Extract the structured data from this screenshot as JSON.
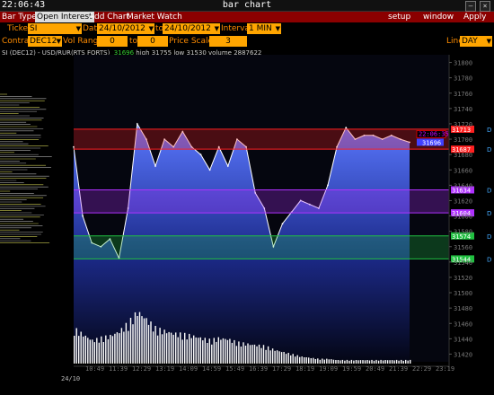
{
  "window": {
    "clock": "22:06:43",
    "title": "bar chart"
  },
  "menu": {
    "items": [
      "Bar Type",
      "Open Interest",
      "Add Chart",
      "Market Watch"
    ],
    "active": "Open Interest",
    "right": [
      "setup",
      "window",
      "Apply"
    ]
  },
  "controls": {
    "ticker_label": "Ticker",
    "ticker_value": "SI",
    "date_label": "Date",
    "date_from": "24/10/2012",
    "to_label": "to",
    "date_to": "24/10/2012",
    "interval_label": "Interval",
    "interval_value": "1 MIN",
    "contract_label": "Contract",
    "contract_value": "DEC12",
    "vol_range_label": "Vol Range",
    "vol_from": "0",
    "vol_to_label": "to",
    "vol_to": "0",
    "price_scale_label": "Price Scale",
    "price_scale_value": "3",
    "line_label": "Line",
    "line_value": "DAY"
  },
  "info": {
    "symbol": "SI (DEC12) - USD/RUR(RTS FORTS)",
    "last": "31696",
    "high_label": "high",
    "high": "31755",
    "low_label": "low",
    "low": "31530",
    "volume_label": "volume",
    "volume": "2887622"
  },
  "price_axis": [
    "31800",
    "31780",
    "31760",
    "31740",
    "31720",
    "31700",
    "31680",
    "31660",
    "31640",
    "31620",
    "31600",
    "31580",
    "31560",
    "31540",
    "31520",
    "31500",
    "31480",
    "31460",
    "31440",
    "31420"
  ],
  "time_axis": [
    "10:49",
    "11:39",
    "12:29",
    "13:19",
    "14:09",
    "14:59",
    "15:49",
    "16:39",
    "17:29",
    "18:19",
    "19:09",
    "19:59",
    "20:49",
    "21:39",
    "22:29",
    "23:19"
  ],
  "date_label": "24/10",
  "bands": [
    {
      "color": "#ff2020",
      "top": "31713",
      "bottom": "31687",
      "label_top": "31713",
      "label_bottom": "31687"
    },
    {
      "color": "#b030ff",
      "top": "31634",
      "bottom": "31604",
      "label_top": "31634",
      "label_bottom": "31604"
    },
    {
      "color": "#20c040",
      "top": "31574",
      "bottom": "31544",
      "label_top": "31574",
      "label_bottom": "31544"
    }
  ],
  "tags": {
    "time": "22:06:35",
    "price": "31696"
  },
  "colors": {
    "menu_bg": "#8b0000",
    "field_bg": "#ffa500",
    "label": "#ff8c00"
  },
  "chart_data": {
    "type": "area",
    "title": "SI (DEC12) - USD/RUR(RTS FORTS)",
    "ylim": [
      31410,
      31810
    ],
    "series": [
      {
        "name": "price",
        "x": [
          "10:00",
          "10:20",
          "10:40",
          "11:00",
          "11:20",
          "11:40",
          "12:00",
          "12:20",
          "12:40",
          "13:00",
          "13:20",
          "13:40",
          "14:00",
          "14:20",
          "14:40",
          "15:00",
          "15:20",
          "15:40",
          "16:00",
          "16:20",
          "16:40",
          "17:00",
          "17:20",
          "17:40",
          "18:00",
          "18:20",
          "18:40",
          "19:00",
          "19:20",
          "19:40",
          "20:00",
          "20:20",
          "20:40",
          "21:00",
          "21:20",
          "21:40",
          "22:00",
          "22:06"
        ],
        "values": [
          31690,
          31600,
          31565,
          31560,
          31570,
          31545,
          31610,
          31720,
          31700,
          31665,
          31700,
          31690,
          31710,
          31690,
          31680,
          31660,
          31690,
          31665,
          31700,
          31690,
          31630,
          31610,
          31560,
          31590,
          31605,
          31620,
          31615,
          31610,
          31640,
          31690,
          31715,
          31700,
          31705,
          31705,
          31700,
          31705,
          31700,
          31696
        ]
      },
      {
        "name": "volume",
        "values": [
          30,
          25,
          20,
          22,
          24,
          28,
          35,
          45,
          38,
          30,
          28,
          26,
          25,
          24,
          22,
          20,
          22,
          21,
          18,
          17,
          16,
          15,
          12,
          10,
          8,
          6,
          5,
          4,
          4,
          3,
          3,
          3,
          3,
          3,
          3,
          3,
          3,
          3
        ]
      }
    ]
  }
}
